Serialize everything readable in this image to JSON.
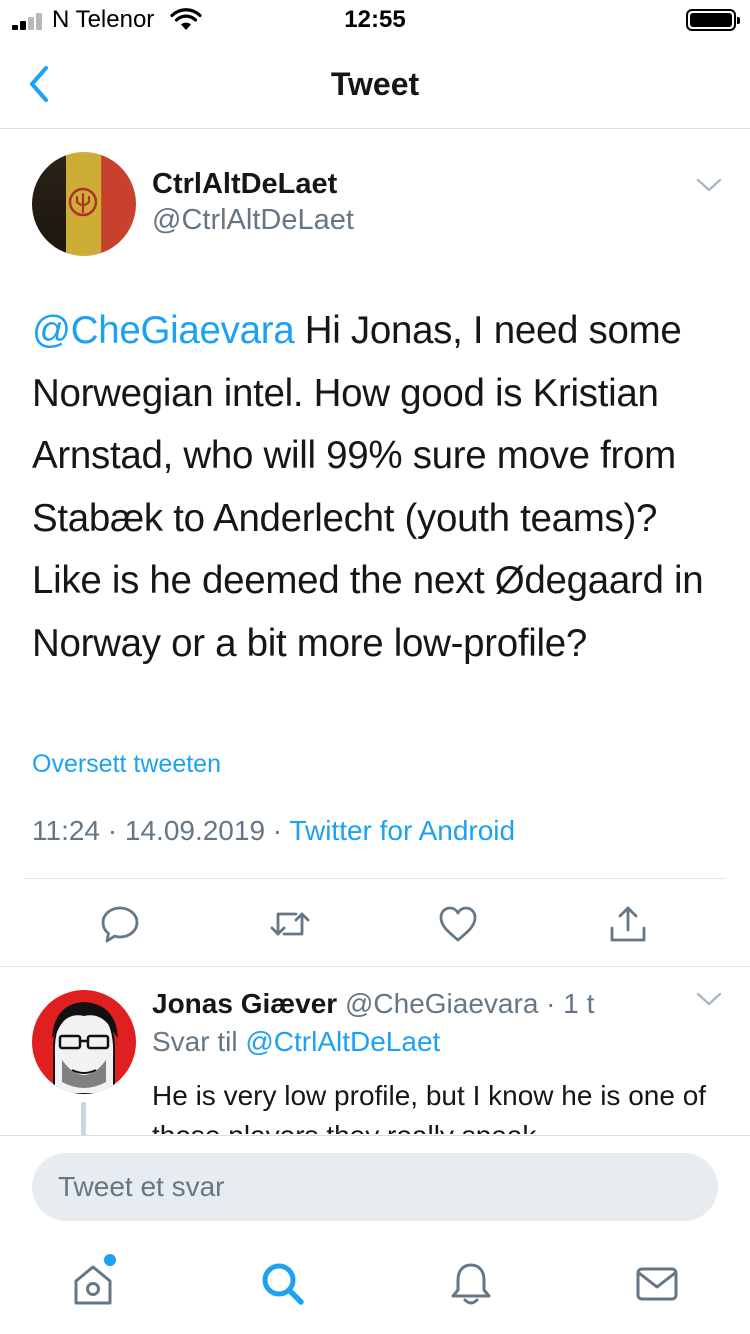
{
  "status_bar": {
    "carrier": "N Telenor",
    "time": "12:55"
  },
  "nav": {
    "title": "Tweet"
  },
  "tweet": {
    "author_name": "CtrlAltDeLaet",
    "author_handle": "@CtrlAltDeLaet",
    "mention": "@CheGiaevara",
    "body": " Hi Jonas, I need some Norwegian intel. How good is Kristian Arnstad, who will 99% sure move from Stabæk to Anderlecht (youth teams)? Like is he deemed the next Ødegaard in Norway or a bit more low-profile?",
    "translate_label": "Oversett tweeten",
    "time": "11:24",
    "date": "14.09.2019",
    "separator": " · ",
    "source": "Twitter for Android"
  },
  "actions": [
    "reply-icon",
    "retweet-icon",
    "like-icon",
    "share-icon"
  ],
  "reply": {
    "author_name": "Jonas Giæver",
    "author_handle": "@CheGiaevara",
    "age": "· 1 t",
    "reply_to_label": "Svar til",
    "reply_to_handle": "@CtrlAltDeLaet",
    "body": "He is very low profile, but I know he is one of those players they really speak"
  },
  "compose": {
    "placeholder": "Tweet et svar"
  },
  "tabs": [
    "home-icon",
    "search-icon",
    "notifications-icon",
    "messages-icon"
  ],
  "colors": {
    "accent": "#1da1f2",
    "text": "#14171a",
    "muted": "#657786"
  }
}
